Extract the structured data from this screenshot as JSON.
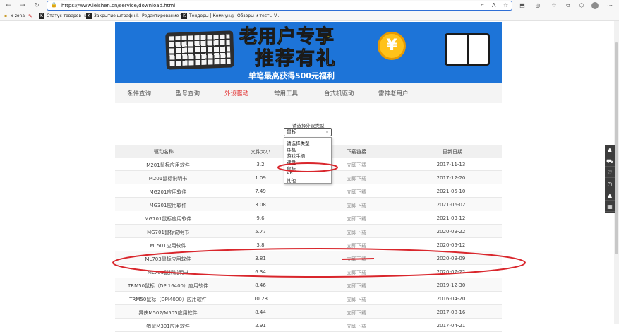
{
  "browser": {
    "url": "https://www.leishen.cn/service/download.html",
    "bookmarks": [
      {
        "label": "x-zona",
        "icon": "folder-icon"
      },
      {
        "label": "Статус товаров на...",
        "icon": "k-icon"
      },
      {
        "label": "Закрытие штрафн...",
        "icon": "pen-icon"
      },
      {
        "label": "Редактирование т...",
        "icon": "gear-icon"
      },
      {
        "label": "Тендеры | Коммун...",
        "icon": "k-icon"
      },
      {
        "label": "Обзоры и тесты V...",
        "icon": "globe-icon"
      }
    ]
  },
  "banner": {
    "title_line1": "老用户专享",
    "title_line2": "推荐有礼",
    "subtitle": "单笔最高获得500元福利",
    "coin_symbol": "¥",
    "bg_color": "#1d74d8"
  },
  "tabs": [
    {
      "label": "条件查询",
      "active": false
    },
    {
      "label": "型号查询",
      "active": false
    },
    {
      "label": "外设驱动",
      "active": true
    },
    {
      "label": "常用工具",
      "active": false
    },
    {
      "label": "台式机驱动",
      "active": false
    },
    {
      "label": "雷神老用户",
      "active": false
    }
  ],
  "selector": {
    "label": "请选择外设类型",
    "selected": "鼠标",
    "options": [
      "请选择类型",
      "耳机",
      "游戏手柄",
      "键盘",
      "鼠标",
      "VR",
      "其他"
    ]
  },
  "table": {
    "headers": [
      "驱动名称",
      "文件大小",
      "下载链接",
      "更新日期"
    ],
    "rows": [
      {
        "name": "M201鼠标应用软件",
        "size": "3.2",
        "link": "立即下载",
        "date": "2017-11-13"
      },
      {
        "name": "M201鼠标说明书",
        "size": "1.09",
        "link": "立即下载",
        "date": "2017-12-20"
      },
      {
        "name": "MG201应用软件",
        "size": "7.49",
        "link": "立即下载",
        "date": "2021-05-10"
      },
      {
        "name": "MG301应用软件",
        "size": "3.08",
        "link": "立即下载",
        "date": "2021-06-02"
      },
      {
        "name": "MG701鼠标应用软件",
        "size": "9.6",
        "link": "立即下载",
        "date": "2021-03-12"
      },
      {
        "name": "MG701鼠标说明书",
        "size": "5.77",
        "link": "立即下载",
        "date": "2020-09-22"
      },
      {
        "name": "ML501应用软件",
        "size": "3.8",
        "link": "立即下载",
        "date": "2020-05-12"
      },
      {
        "name": "ML703鼠标应用软件",
        "size": "3.81",
        "link": "立即下载",
        "date": "2020-09-09"
      },
      {
        "name": "ML703鼠标说明书",
        "size": "6.34",
        "link": "立即下载",
        "date": "2020-07-22"
      },
      {
        "name": "TRM50鼠标（DPI16400）应用软件",
        "size": "8.46",
        "link": "立即下载",
        "date": "2019-12-30"
      },
      {
        "name": "TRM50鼠标（DPI4000）应用软件",
        "size": "10.28",
        "link": "立即下载",
        "date": "2016-04-20"
      },
      {
        "name": "异侠M502/M505应用软件",
        "size": "8.44",
        "link": "立即下载",
        "date": "2017-08-16"
      },
      {
        "name": "猎鼠M301应用软件",
        "size": "2.91",
        "link": "立即下载",
        "date": "2017-04-21"
      }
    ]
  },
  "float_bar": [
    "user-icon",
    "cart-icon",
    "heart-icon",
    "history-icon",
    "top-icon",
    "qrcode-icon"
  ],
  "annotation_color": "#d9262c"
}
